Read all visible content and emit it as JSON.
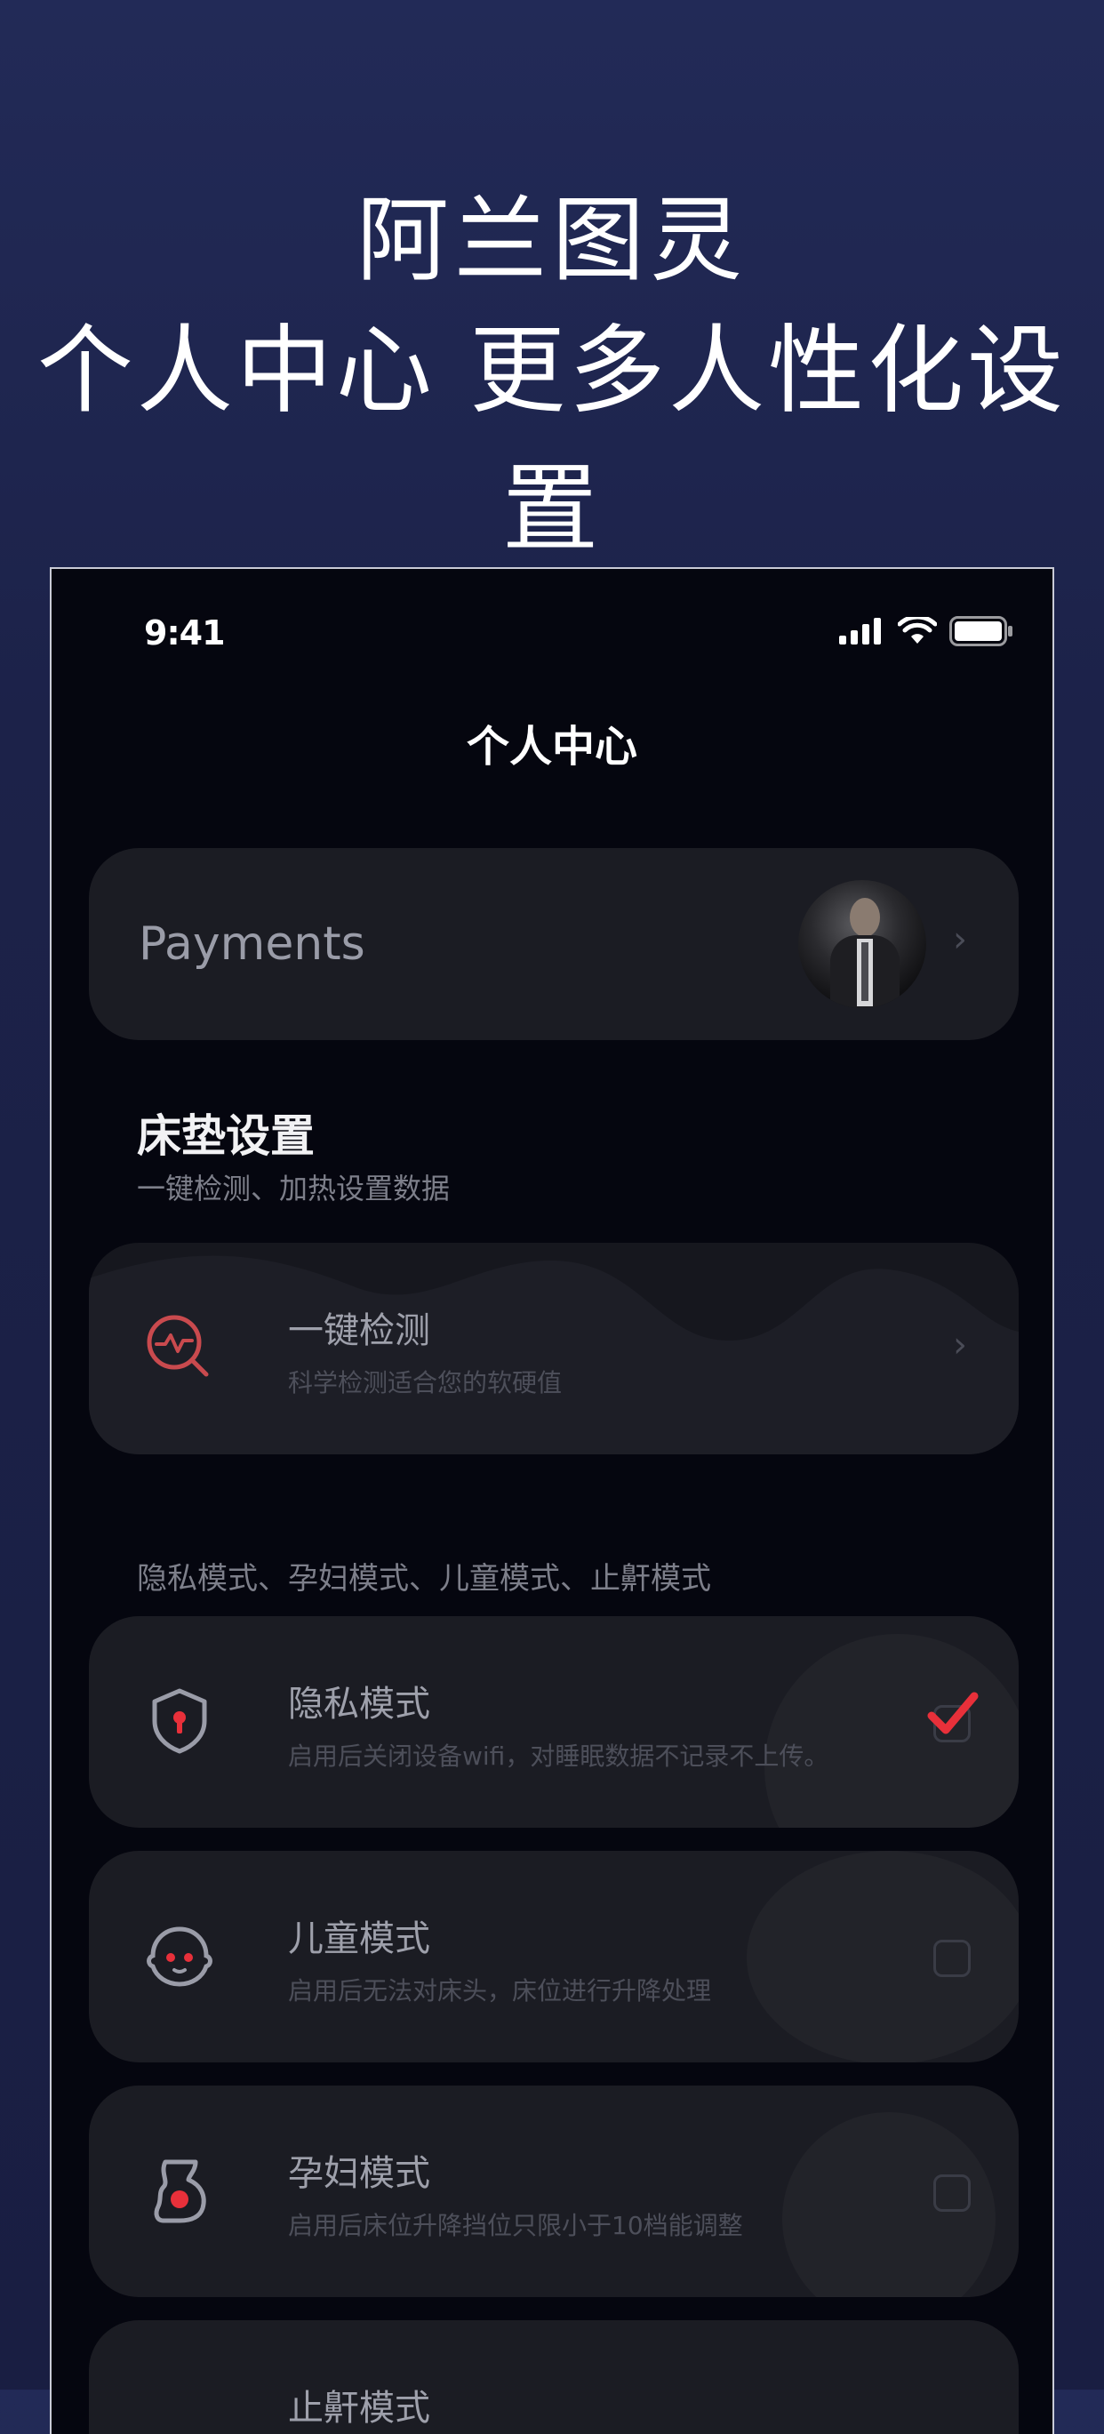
{
  "promo": {
    "line1": "阿兰图灵",
    "line2": "个人中心 更多人性化设置"
  },
  "status_bar": {
    "time": "9:41",
    "icons": [
      "signal-icon",
      "wifi-icon",
      "battery-icon"
    ]
  },
  "nav": {
    "title": "个人中心"
  },
  "profile": {
    "label": "Payments"
  },
  "mattress": {
    "title": "床垫设置",
    "subtitle": "一键检测、加热设置数据",
    "check": {
      "title": "一键检测",
      "desc": "科学检测适合您的软硬值",
      "icon": "detect-icon"
    }
  },
  "modes": {
    "label": "隐私模式、孕妇模式、儿童模式、止鼾模式",
    "items": [
      {
        "title": "隐私模式",
        "desc": "启用后关闭设备wifi，对睡眠数据不记录不上传。",
        "icon": "shield-lock-icon",
        "checked": true
      },
      {
        "title": "儿童模式",
        "desc": "启用后无法对床头，床位进行升降处理",
        "icon": "child-face-icon",
        "checked": false
      },
      {
        "title": "孕妇模式",
        "desc": "启用后床位升降挡位只限小于10档能调整",
        "icon": "pregnant-icon",
        "checked": false
      },
      {
        "title": "止鼾模式",
        "desc": "",
        "icon": "snore-icon",
        "checked": false
      }
    ]
  },
  "colors": {
    "accent_red": "#e8303a",
    "card_bg": "#1b1c23",
    "screen_bg": "#05060f",
    "page_bg": "#1f2550"
  }
}
